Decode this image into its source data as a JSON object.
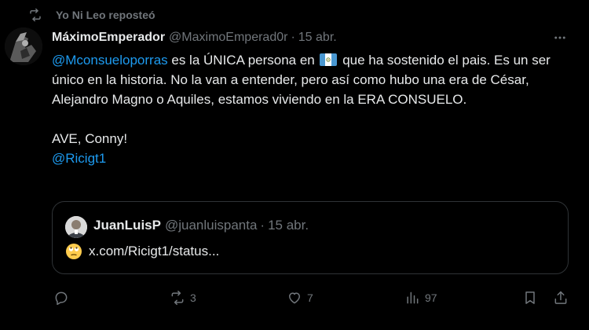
{
  "repost": {
    "text": "Yo Ni Leo reposteó",
    "icon": "repost-icon"
  },
  "post": {
    "author_name": "MáximoEmperador",
    "author_handle": "@MaximoEmperad0r",
    "separator": "·",
    "date": "15 abr.",
    "more_icon": "more-icon",
    "mention1": "@Mconsueloporras",
    "text_part1": " es la ÚNICA persona en ",
    "flag_icon": "guatemala-flag-icon",
    "text_part2": " que ha sostenido el pais. Es un ser único en la historia. No la van a entender, pero así como hubo una era de César, Alejandro Magno o Aquiles, estamos viviendo en la ERA CONSUELO.",
    "text_part3": "AVE, Conny!",
    "mention2": "@Ricigt1"
  },
  "quote": {
    "author_name": "JuanLuisP",
    "author_handle": "@juanluispanta",
    "separator": "·",
    "date": "15 abr.",
    "emoji_icon": "face-with-rolling-eyes-icon",
    "link_text": "x.com/Ricigt1/status..."
  },
  "actions": {
    "reply": {
      "icon": "reply-icon",
      "count": ""
    },
    "repost": {
      "icon": "repost-icon",
      "count": "3"
    },
    "like": {
      "icon": "heart-icon",
      "count": "7"
    },
    "views": {
      "icon": "views-icon",
      "count": "97"
    },
    "bookmark": {
      "icon": "bookmark-icon"
    },
    "share": {
      "icon": "share-icon"
    }
  },
  "colors": {
    "background": "#000000",
    "text": "#e7e9ea",
    "muted": "#71767b",
    "link": "#1d9bf0",
    "border": "#2f3336"
  }
}
